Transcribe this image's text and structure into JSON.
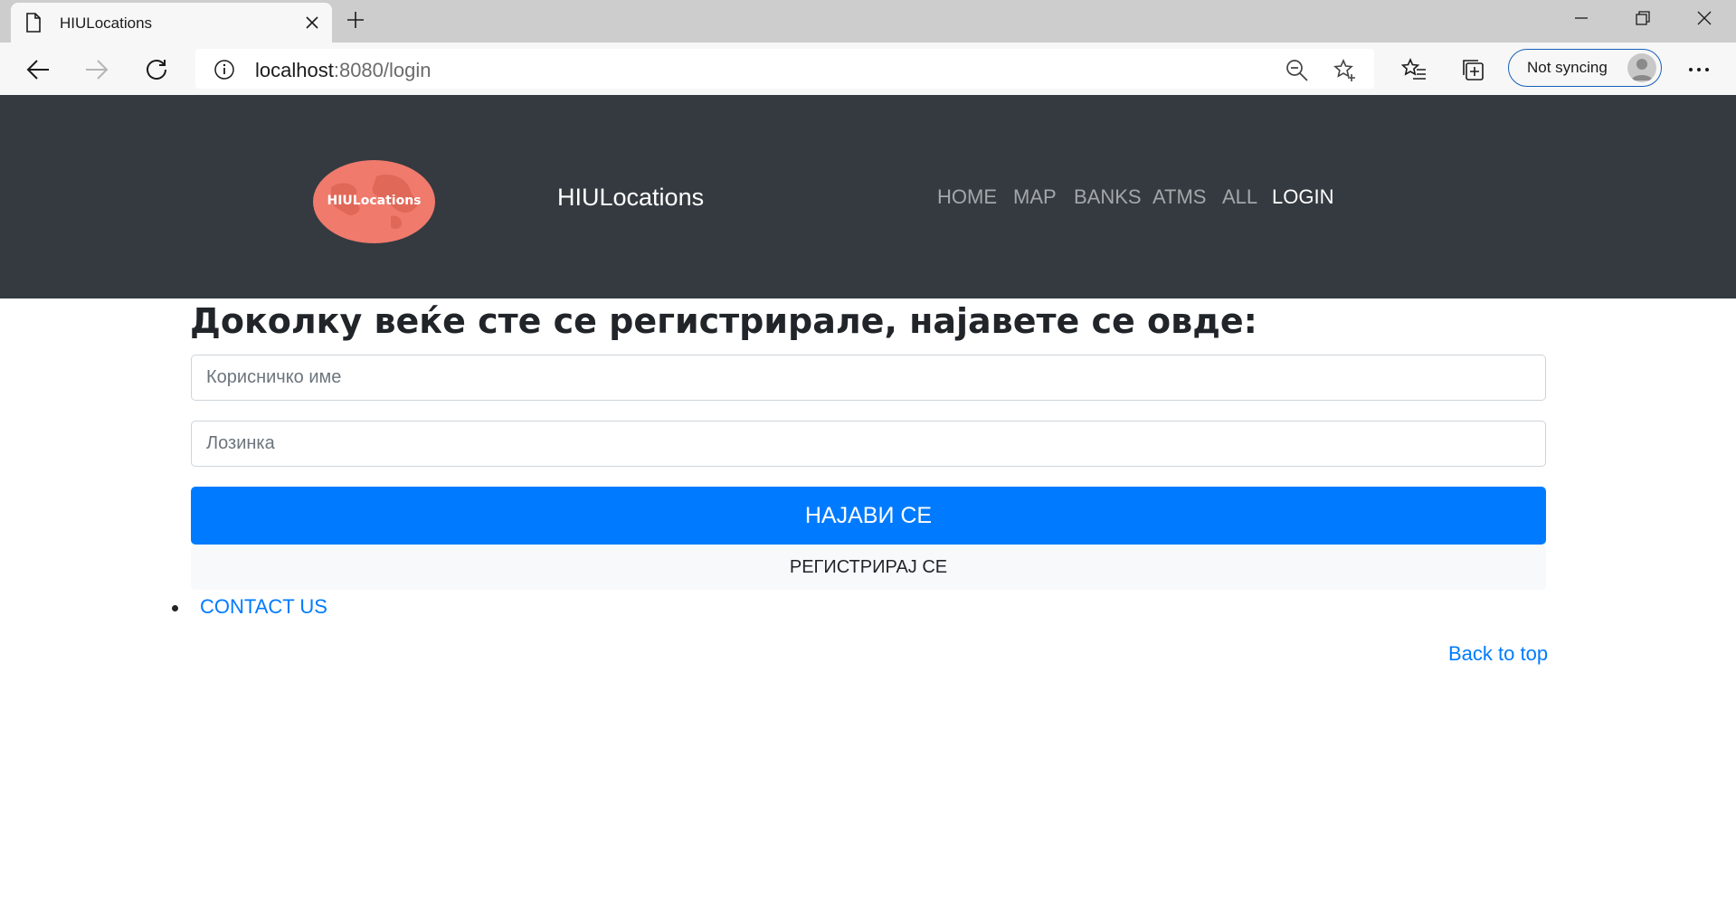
{
  "browser": {
    "tab_title": "HIULocations",
    "url_host": "localhost",
    "url_rest": ":8080/login",
    "sync_label": "Not syncing"
  },
  "site": {
    "logo_text": "HIULocations",
    "brand": "HIULocations",
    "nav": [
      "HOME",
      "MAP",
      "BANKS",
      "ATMS",
      "ALL",
      "LOGIN"
    ],
    "active_nav": "LOGIN"
  },
  "login": {
    "heading": "Доколку веќе сте се регистрирале, најавете се овде:",
    "username_placeholder": "Корисничко име",
    "password_placeholder": "Лозинка",
    "login_button": "НАЈАВИ СЕ",
    "register_button": "РЕГИСТРИРАЈ СЕ"
  },
  "footer": {
    "contact": "CONTACT US",
    "back_to_top": "Back to top"
  },
  "colors": {
    "navbar_bg": "#343a40",
    "primary": "#007bff",
    "logo_bg": "#f07a6c"
  }
}
